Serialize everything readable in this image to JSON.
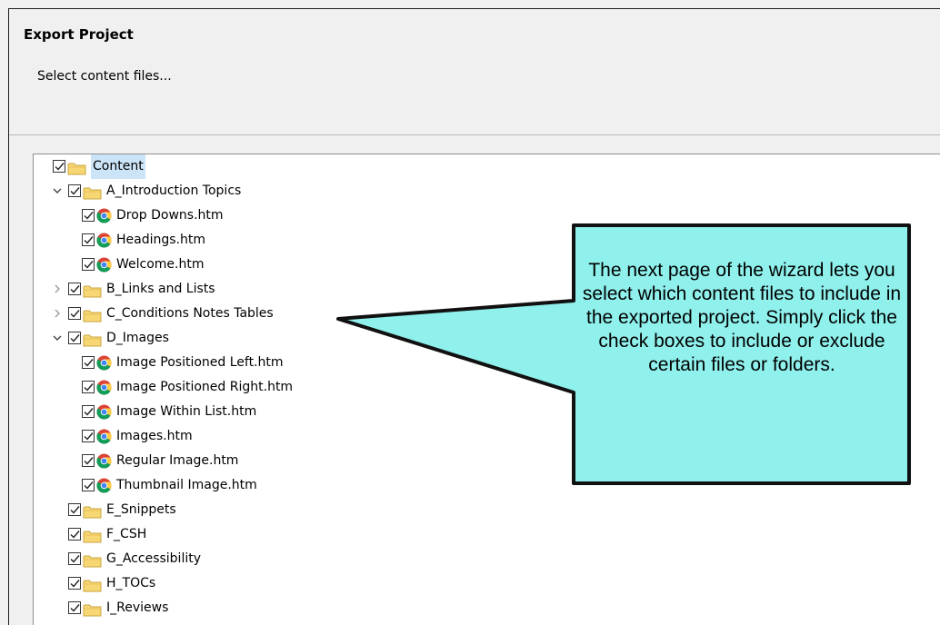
{
  "dialog": {
    "title": "Export Project",
    "subtitle": "Select content files..."
  },
  "tree": {
    "items": [
      {
        "label": "Content",
        "type": "folder",
        "depth": 0,
        "expander": "none",
        "selected": true
      },
      {
        "label": "A_Introduction Topics",
        "type": "folder",
        "depth": 1,
        "expander": "expanded"
      },
      {
        "label": "Drop Downs.htm",
        "type": "file",
        "depth": 2,
        "expander": "none"
      },
      {
        "label": "Headings.htm",
        "type": "file",
        "depth": 2,
        "expander": "none"
      },
      {
        "label": "Welcome.htm",
        "type": "file",
        "depth": 2,
        "expander": "none"
      },
      {
        "label": "B_Links and Lists",
        "type": "folder",
        "depth": 1,
        "expander": "collapsed"
      },
      {
        "label": "C_Conditions Notes Tables",
        "type": "folder",
        "depth": 1,
        "expander": "collapsed"
      },
      {
        "label": "D_Images",
        "type": "folder",
        "depth": 1,
        "expander": "expanded"
      },
      {
        "label": "Image Positioned Left.htm",
        "type": "file",
        "depth": 2,
        "expander": "none"
      },
      {
        "label": "Image Positioned Right.htm",
        "type": "file",
        "depth": 2,
        "expander": "none"
      },
      {
        "label": "Image Within List.htm",
        "type": "file",
        "depth": 2,
        "expander": "none"
      },
      {
        "label": "Images.htm",
        "type": "file",
        "depth": 2,
        "expander": "none"
      },
      {
        "label": "Regular Image.htm",
        "type": "file",
        "depth": 2,
        "expander": "none"
      },
      {
        "label": "Thumbnail Image.htm",
        "type": "file",
        "depth": 2,
        "expander": "none"
      },
      {
        "label": "E_Snippets",
        "type": "folder",
        "depth": 1,
        "expander": "none"
      },
      {
        "label": "F_CSH",
        "type": "folder",
        "depth": 1,
        "expander": "none"
      },
      {
        "label": "G_Accessibility",
        "type": "folder",
        "depth": 1,
        "expander": "none"
      },
      {
        "label": "H_TOCs",
        "type": "folder",
        "depth": 1,
        "expander": "none"
      },
      {
        "label": "I_Reviews",
        "type": "folder",
        "depth": 1,
        "expander": "none"
      }
    ]
  },
  "callout": {
    "text": "The next page of the wizard lets you select which content files to include in the exported project. Simply click the check boxes to include or exclude certain files or folders.",
    "fill": "#8ff0ec",
    "stroke": "#111111"
  },
  "colors": {
    "selection": "#cce4f7",
    "folder": "#f7d774",
    "window_bg": "#f0f0f0"
  },
  "icons": {
    "checkbox": "checked-checkbox-icon",
    "folder": "folder-icon",
    "file": "chrome-file-icon",
    "expanded": "chevron-down-icon",
    "collapsed": "chevron-right-icon"
  }
}
